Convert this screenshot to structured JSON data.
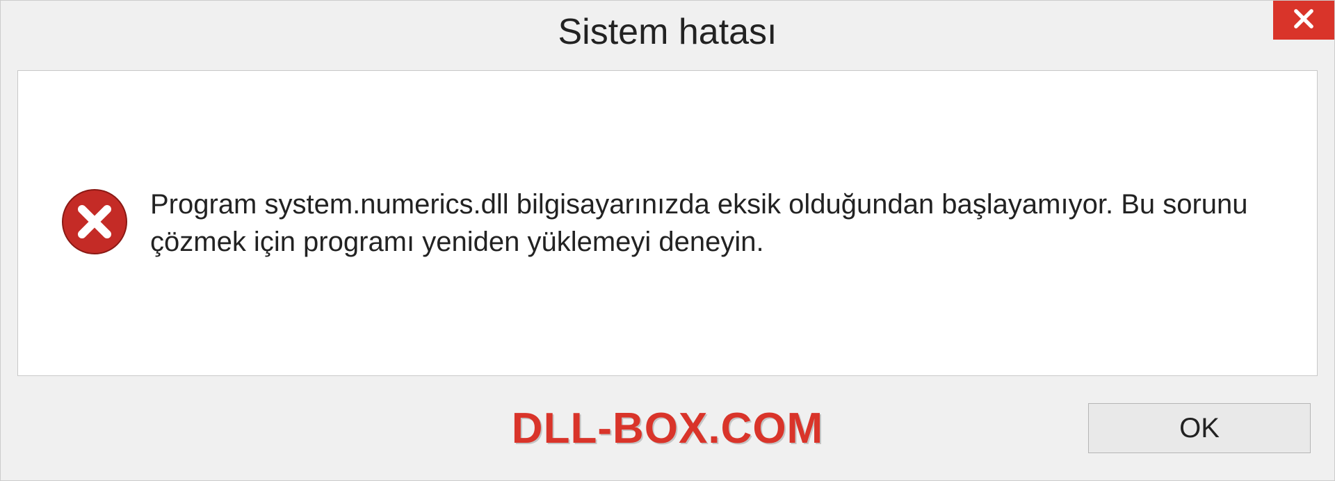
{
  "dialog": {
    "title": "Sistem hatası",
    "message": "Program system.numerics.dll bilgisayarınızda eksik olduğundan başlayamıyor. Bu sorunu çözmek için programı yeniden yüklemeyi deneyin.",
    "ok_label": "OK",
    "brand": "DLL-BOX.COM"
  },
  "colors": {
    "accent_red": "#d9342a"
  }
}
